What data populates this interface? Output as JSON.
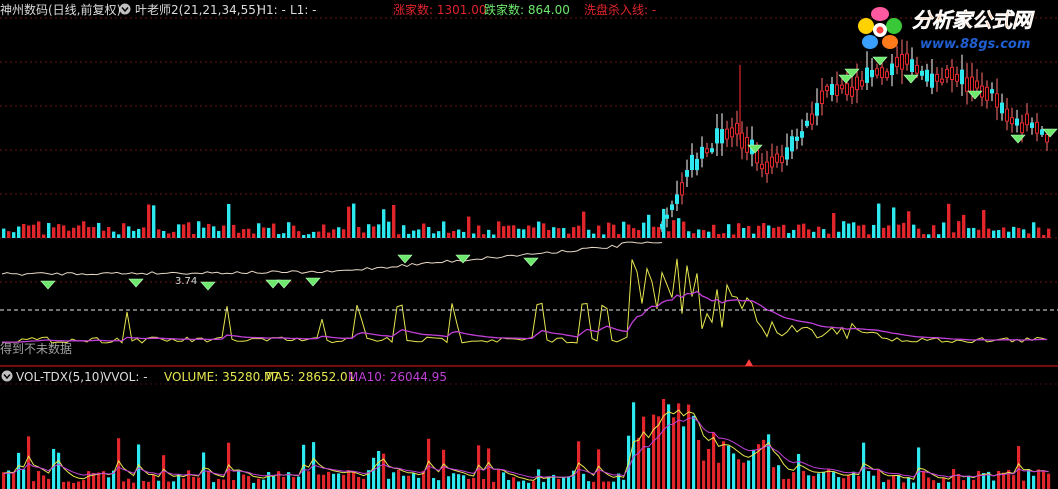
{
  "colors": {
    "background": "#000000",
    "up": "#e0252b",
    "down": "#2ee8f0",
    "grid": "#8b1a1a",
    "panel_border": "#a01010",
    "white_line": "#ffffff",
    "yellow_line": "#e6e650",
    "magenta_line": "#c040d8",
    "marker": "#6de86d",
    "logo_orange": "#ff6a00",
    "logo_blue": "#1f5fd0"
  },
  "header": {
    "title": "神州数码(日线,前复权)",
    "indicator": "叶老师2(21,21,34,55)",
    "h1": "H1: -",
    "l1": "L1: -",
    "up_count": "涨家数: 1301.00",
    "down_count": "跌家数: 864.00",
    "wash_line": "洗盘杀入线: -"
  },
  "logo": {
    "cn": "分析家公式网",
    "url": "www.88gs.com"
  },
  "main_panel": {
    "level_label": "3.74",
    "notice_text": "得到不未数据"
  },
  "volume_panel": {
    "indicator": "VOL-TDX(5,10)",
    "vvol": "VVOL: -",
    "volume": "VOLUME: 35280.77",
    "ma5": "MA5: 28652.01",
    "ma10": "MA10: 26044.95"
  },
  "chart_data": {
    "type": "line",
    "series": [
      {
        "name": "VOLUME",
        "last": 35280.77
      },
      {
        "name": "MA5",
        "last": 28652.01
      },
      {
        "name": "MA10",
        "last": 26044.95
      }
    ],
    "breadth": {
      "up": 1301,
      "down": 864
    }
  }
}
